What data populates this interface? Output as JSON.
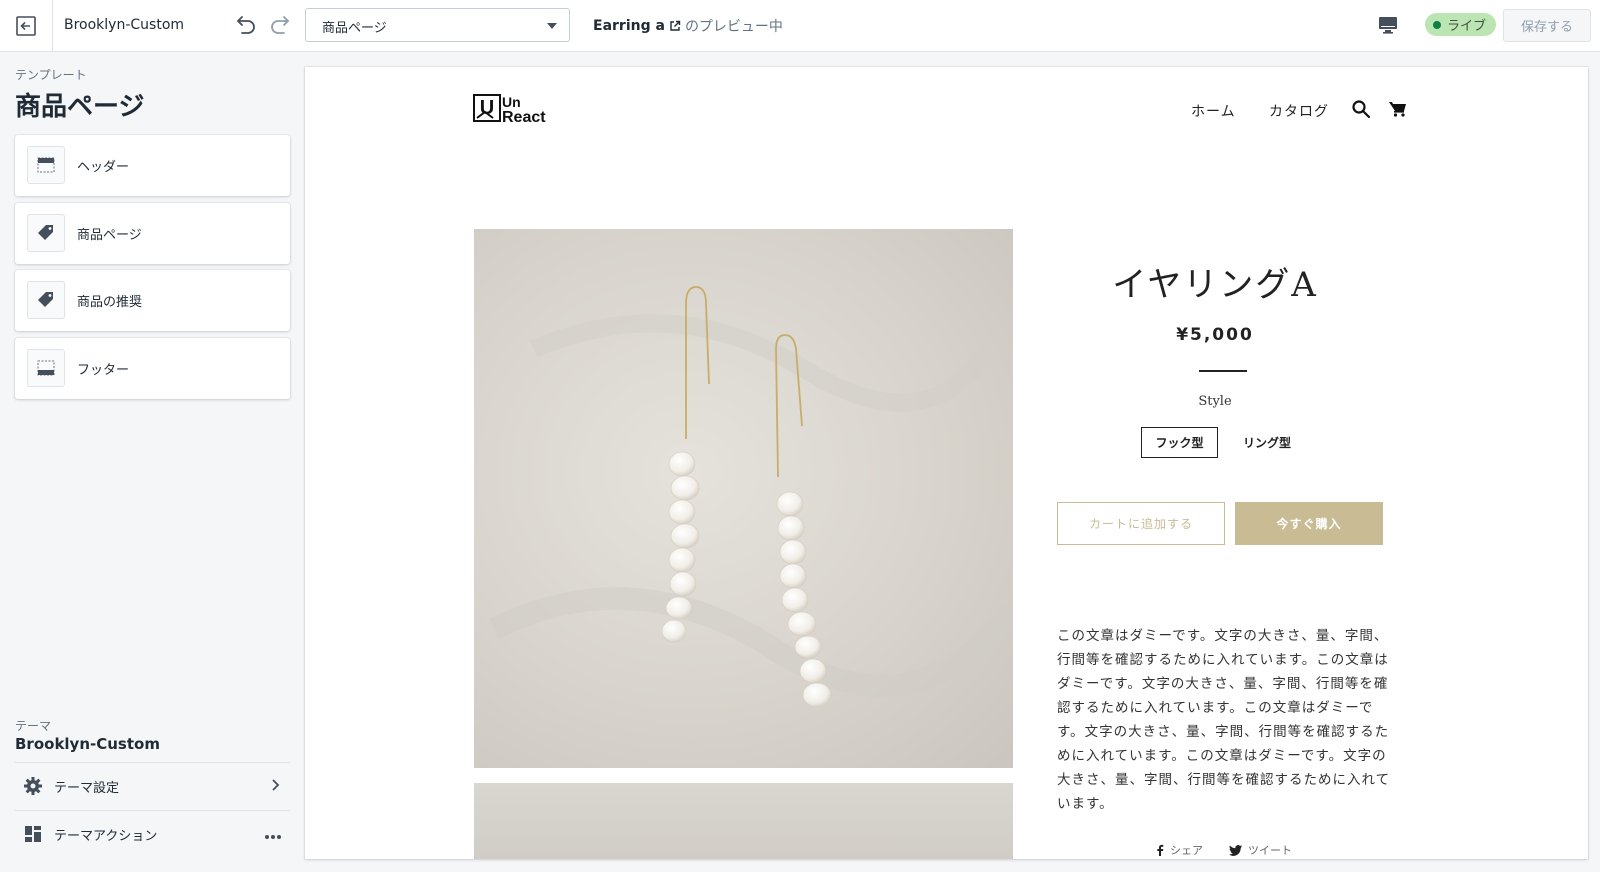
{
  "topbar": {
    "theme_name": "Brooklyn-Custom",
    "page_select_value": "商品ページ",
    "preview_product": "Earring a",
    "preview_suffix": "のプレビュー中",
    "live_label": "ライブ",
    "save_label": "保存する",
    "icons": [
      "exit-icon",
      "undo-icon",
      "redo-icon",
      "external-link-icon",
      "desktop-icon"
    ]
  },
  "sidebar": {
    "template_label": "テンプレート",
    "template_title": "商品ページ",
    "sections": [
      {
        "label": "ヘッダー",
        "icon": "header-layout-icon"
      },
      {
        "label": "商品ページ",
        "icon": "tag-icon"
      },
      {
        "label": "商品の推奨",
        "icon": "tag-icon"
      },
      {
        "label": "フッター",
        "icon": "footer-layout-icon"
      }
    ],
    "theme_label": "テーマ",
    "theme_name": "Brooklyn-Custom",
    "theme_settings_label": "テーマ設定",
    "theme_actions_label": "テーマアクション"
  },
  "storefront": {
    "logo_text_top": "Un",
    "logo_text_bottom": "React",
    "logo_letter": "U",
    "nav": [
      "ホーム",
      "カタログ"
    ],
    "product_title": "イヤリングA",
    "price": "¥5,000",
    "style_label": "Style",
    "variants": [
      "フック型",
      "リング型"
    ],
    "selected_variant": "フック型",
    "add_to_cart": "カートに追加する",
    "buy_now": "今すぐ購入",
    "description": "この文章はダミーです。文字の大きさ、量、字間、行間等を確認するために入れています。この文章はダミーです。文字の大きさ、量、字間、行間等を確認するために入れています。この文章はダミーです。文字の大きさ、量、字間、行間等を確認するために入れています。この文章はダミーです。文字の大きさ、量、字間、行間等を確認するために入れています。",
    "share_label": "シェア",
    "tweet_label": "ツイート"
  },
  "colors": {
    "accent_gold": "#c9bb94",
    "live_badge_bg": "#bbe5b3",
    "live_dot": "#108043"
  }
}
